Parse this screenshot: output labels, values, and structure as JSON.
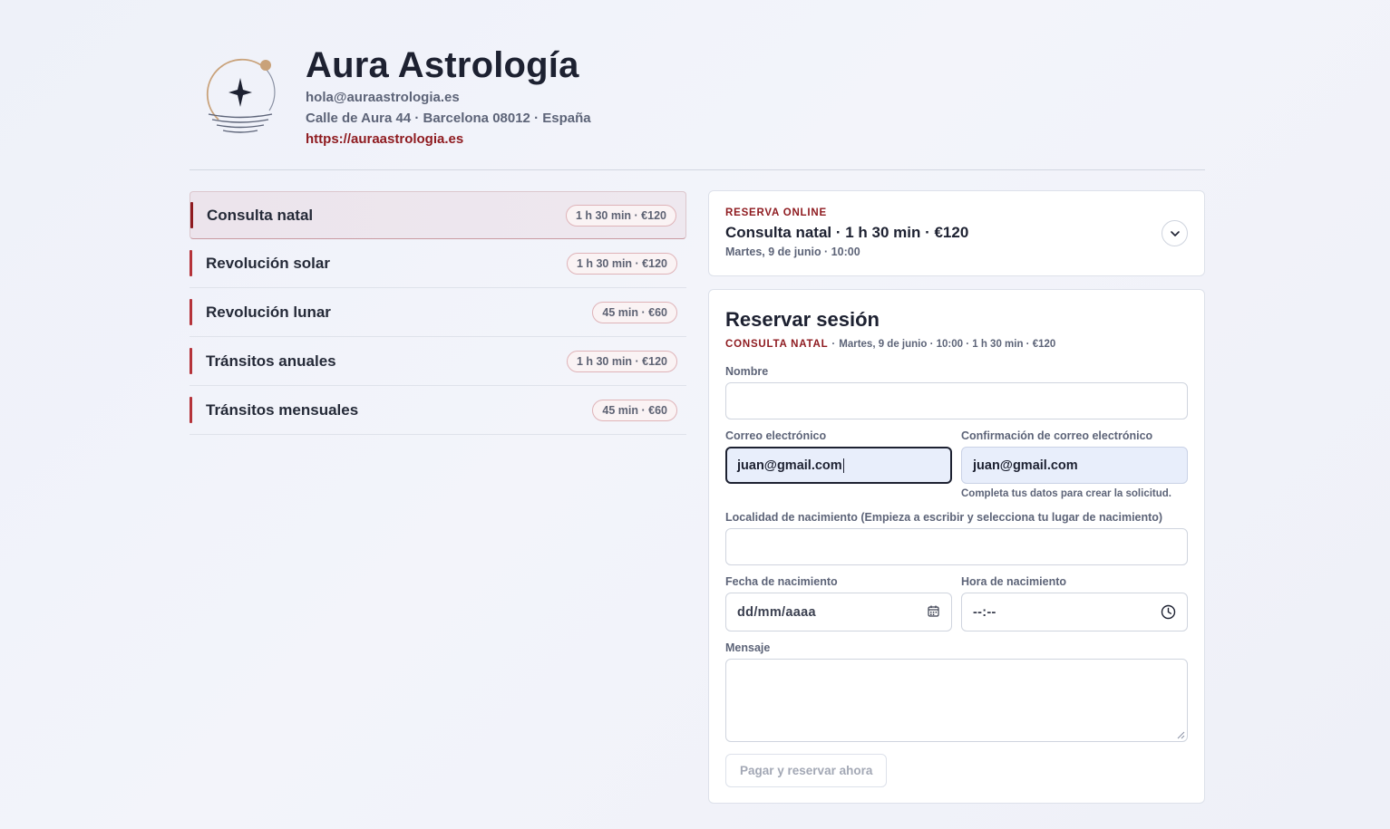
{
  "brand": {
    "name": "Aura Astrología",
    "email": "hola@auraastrologia.es",
    "address": "Calle de Aura 44 · Barcelona 08012 · España",
    "website": "https://auraastrologia.es"
  },
  "services": [
    {
      "name": "Consulta natal",
      "badge": "1 h 30 min · €120",
      "active": true
    },
    {
      "name": "Revolución solar",
      "badge": "1 h 30 min · €120",
      "active": false
    },
    {
      "name": "Revolución lunar",
      "badge": "45 min · €60",
      "active": false
    },
    {
      "name": "Tránsitos anuales",
      "badge": "1 h 30 min · €120",
      "active": false
    },
    {
      "name": "Tránsitos mensuales",
      "badge": "45 min · €60",
      "active": false
    }
  ],
  "summary": {
    "eyebrow": "RESERVA ONLINE",
    "title": "Consulta natal · 1 h 30 min · €120",
    "subtitle": "Martes, 9 de junio · 10:00"
  },
  "form": {
    "title": "Reservar sesión",
    "meta_service": "CONSULTA NATAL",
    "meta_separator": "·",
    "meta_info": "Martes, 9 de junio · 10:00 · 1 h 30 min · €120",
    "name_label": "Nombre",
    "name_value": "",
    "email_label": "Correo electrónico",
    "email_value": "juan@gmail.com",
    "email_confirm_label": "Confirmación de correo electrónico",
    "email_confirm_value": "juan@gmail.com",
    "hint": "Completa tus datos para crear la solicitud.",
    "birthplace_label": "Localidad de nacimiento (Empieza a escribir y selecciona tu lugar de nacimiento)",
    "birthplace_value": "",
    "birthdate_label": "Fecha de nacimiento",
    "birthdate_placeholder": "dd/mm/aaaa",
    "birthtime_label": "Hora de nacimiento",
    "birthtime_placeholder": "--:--",
    "message_label": "Mensaje",
    "submit_label": "Pagar y reservar ahora"
  },
  "colors": {
    "accent": "#8e1a1f",
    "gold": "#c9a27a",
    "text": "#1d2131",
    "muted": "#5d6478"
  },
  "icons": {
    "logo": "star-orbit-logo",
    "chevron": "chevron-down-icon",
    "calendar": "calendar-icon",
    "clock": "clock-icon"
  }
}
